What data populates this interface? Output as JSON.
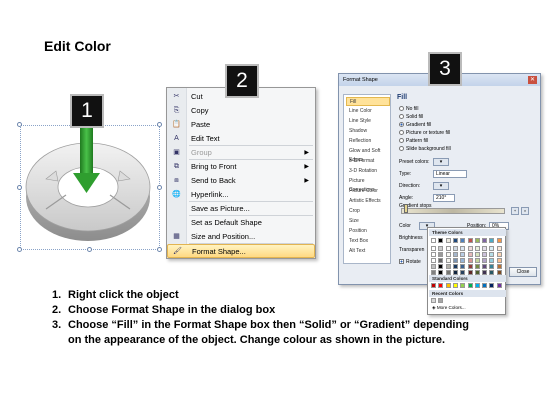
{
  "title": "Edit Color",
  "badges": [
    "1",
    "2",
    "3"
  ],
  "context_menu": {
    "items": [
      {
        "label": "Cut",
        "icon": "scissors-icon",
        "glyph": "✂"
      },
      {
        "label": "Copy",
        "icon": "copy-icon",
        "glyph": "⎘"
      },
      {
        "label": "Paste",
        "icon": "paste-icon",
        "glyph": "📋"
      },
      {
        "label": "Edit Text",
        "icon": "edit-text-icon",
        "glyph": "A"
      },
      {
        "label": "Group",
        "icon": "group-icon",
        "glyph": "▣",
        "disabled": true,
        "submenu": true
      },
      {
        "label": "Bring to Front",
        "icon": "bring-to-front-icon",
        "glyph": "⧉",
        "submenu": true
      },
      {
        "label": "Send to Back",
        "icon": "send-to-back-icon",
        "glyph": "⧈",
        "submenu": true
      },
      {
        "label": "Hyperlink...",
        "icon": "hyperlink-icon",
        "glyph": "🌐"
      },
      {
        "label": "Save as Picture..."
      },
      {
        "label": "Set as Default Shape"
      },
      {
        "label": "Size and Position...",
        "icon": "size-position-icon",
        "glyph": "▦"
      },
      {
        "label": "Format Shape...",
        "icon": "format-shape-icon",
        "glyph": "🖌",
        "active": true
      }
    ]
  },
  "format_dialog": {
    "title": "Format Shape",
    "nav": [
      "Fill",
      "Line Color",
      "Line Style",
      "Shadow",
      "Reflection",
      "Glow and Soft Edges",
      "3-D Format",
      "3-D Rotation",
      "Picture Corrections",
      "Picture Color",
      "Artistic Effects",
      "Crop",
      "Size",
      "Position",
      "Text Box",
      "Alt Text"
    ],
    "selected_nav": "Fill",
    "section_title": "Fill",
    "fill_options": [
      "No fill",
      "Solid fill",
      "Gradient fill",
      "Picture or texture fill",
      "Pattern fill",
      "Slide background fill"
    ],
    "selected_fill": "Gradient fill",
    "preset_colors_label": "Preset colors:",
    "type_label": "Type:",
    "type_value": "Linear",
    "direction_label": "Direction:",
    "angle_label": "Angle:",
    "angle_value": "210°",
    "gradient_stops_label": "Gradient stops",
    "color_label": "Color",
    "position_label": "Position:",
    "position_value": "0%",
    "brightness_label": "Brightness",
    "transparency_label": "Transparen",
    "rotate_label": "Rotate",
    "close_label": "Close"
  },
  "color_popup": {
    "theme_colors_label": "Theme Colors",
    "standard_colors_label": "Standard Colors",
    "recent_colors_label": "Recent Colors",
    "more_colors_label": "More Colors...",
    "theme_top": [
      "#ffffff",
      "#000000",
      "#eeece1",
      "#1f497d",
      "#4f81bd",
      "#c0504d",
      "#9bbb59",
      "#8064a2",
      "#4bacc6",
      "#f79646"
    ],
    "standard": [
      "#c00000",
      "#ff0000",
      "#ffc000",
      "#ffff00",
      "#92d050",
      "#00b050",
      "#00b0f0",
      "#0070c0",
      "#002060",
      "#7030a0"
    ],
    "recent": [
      "#d8d8d8",
      "#a6a6a6"
    ]
  },
  "instructions": [
    {
      "num": "1.",
      "text": "Right click the object"
    },
    {
      "num": "2.",
      "text": "Choose Format Shape in the dialog box"
    },
    {
      "num": "3.",
      "text": "Choose “Fill” in the Format Shape box then “Solid” or “Gradient” depending on the appearance of the object. Change colour as shown in the picture."
    }
  ]
}
